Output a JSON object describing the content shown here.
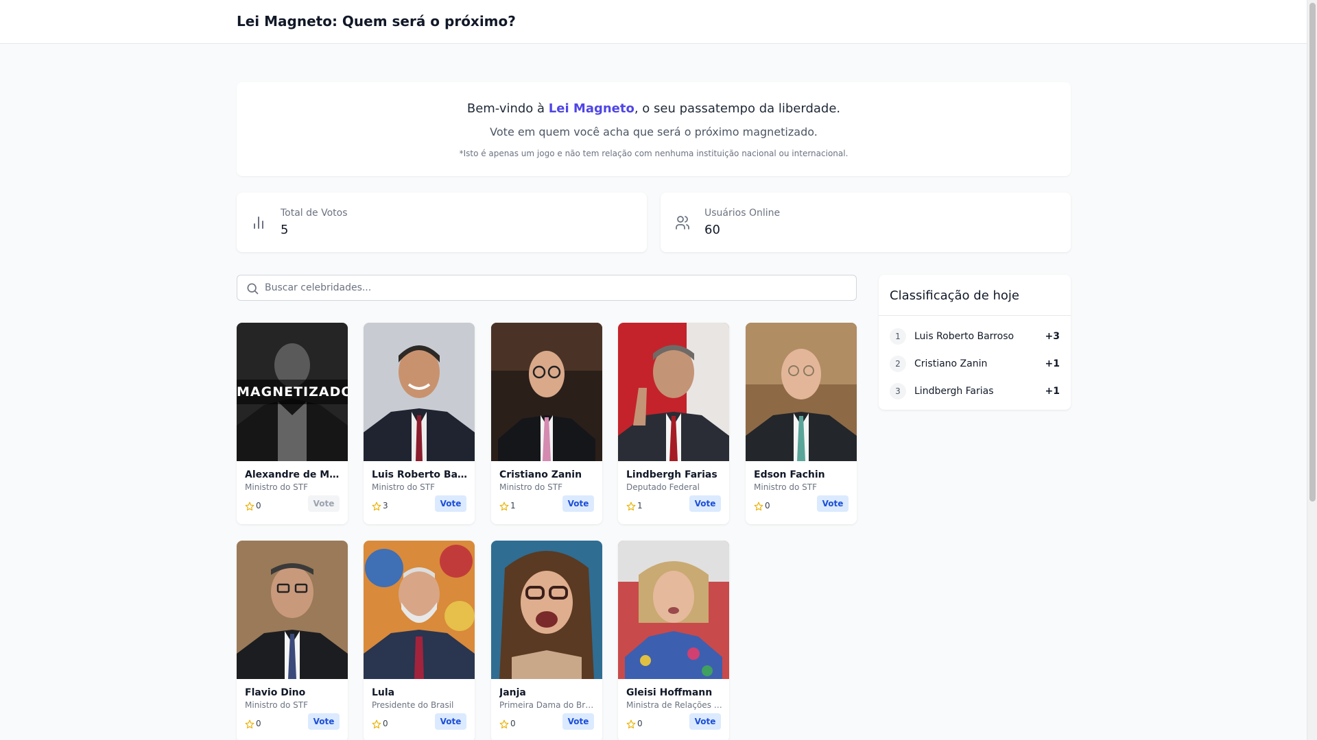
{
  "header": {
    "title": "Lei Magneto: Quem será o próximo?"
  },
  "welcome": {
    "prefix": "Bem-vindo à ",
    "brand": "Lei Magneto",
    "suffix": ", o seu passatempo da liberdade.",
    "subtitle": "Vote em quem você acha que será o próximo magnetizado.",
    "disclaimer": "*Isto é apenas um jogo e não tem relação com nenhuma instituição nacional ou internacional."
  },
  "stats": {
    "total_votes": {
      "label": "Total de Votos",
      "value": "5",
      "icon": "bar-chart-icon"
    },
    "online_users": {
      "label": "Usuários Online",
      "value": "60",
      "icon": "users-icon"
    }
  },
  "search": {
    "placeholder": "Buscar celebridades...",
    "value": ""
  },
  "vote_label": "Vote",
  "magnetized_label": "MAGNETIZADO",
  "celebrities": [
    {
      "name": "Alexandre de Moraes",
      "role": "Ministro do STF",
      "votes": "0",
      "magnetized": true
    },
    {
      "name": "Luis Roberto Barroso",
      "role": "Ministro do STF",
      "votes": "3",
      "magnetized": false
    },
    {
      "name": "Cristiano Zanin",
      "role": "Ministro do STF",
      "votes": "1",
      "magnetized": false
    },
    {
      "name": "Lindbergh Farias",
      "role": "Deputado Federal",
      "votes": "1",
      "magnetized": false
    },
    {
      "name": "Edson Fachin",
      "role": "Ministro do STF",
      "votes": "0",
      "magnetized": false
    },
    {
      "name": "Flavio Dino",
      "role": "Ministro do STF",
      "votes": "0",
      "magnetized": false
    },
    {
      "name": "Lula",
      "role": "Presidente do Brasil",
      "votes": "0",
      "magnetized": false
    },
    {
      "name": "Janja",
      "role": "Primeira Dama do Brasil",
      "votes": "0",
      "magnetized": false
    },
    {
      "name": "Gleisi Hoffmann",
      "role": "Ministra de Relações Institucionais",
      "votes": "0",
      "magnetized": false
    }
  ],
  "ranking": {
    "title": "Classificação de hoje",
    "items": [
      {
        "position": "1",
        "name": "Luis Roberto Barroso",
        "delta": "+3"
      },
      {
        "position": "2",
        "name": "Cristiano Zanin",
        "delta": "+1"
      },
      {
        "position": "3",
        "name": "Lindbergh Farias",
        "delta": "+1"
      }
    ]
  },
  "colors": {
    "brand": "#4f46e5",
    "vote_button_bg": "#dbeafe",
    "vote_button_text": "#1d4ed8",
    "star": "#eab308"
  }
}
